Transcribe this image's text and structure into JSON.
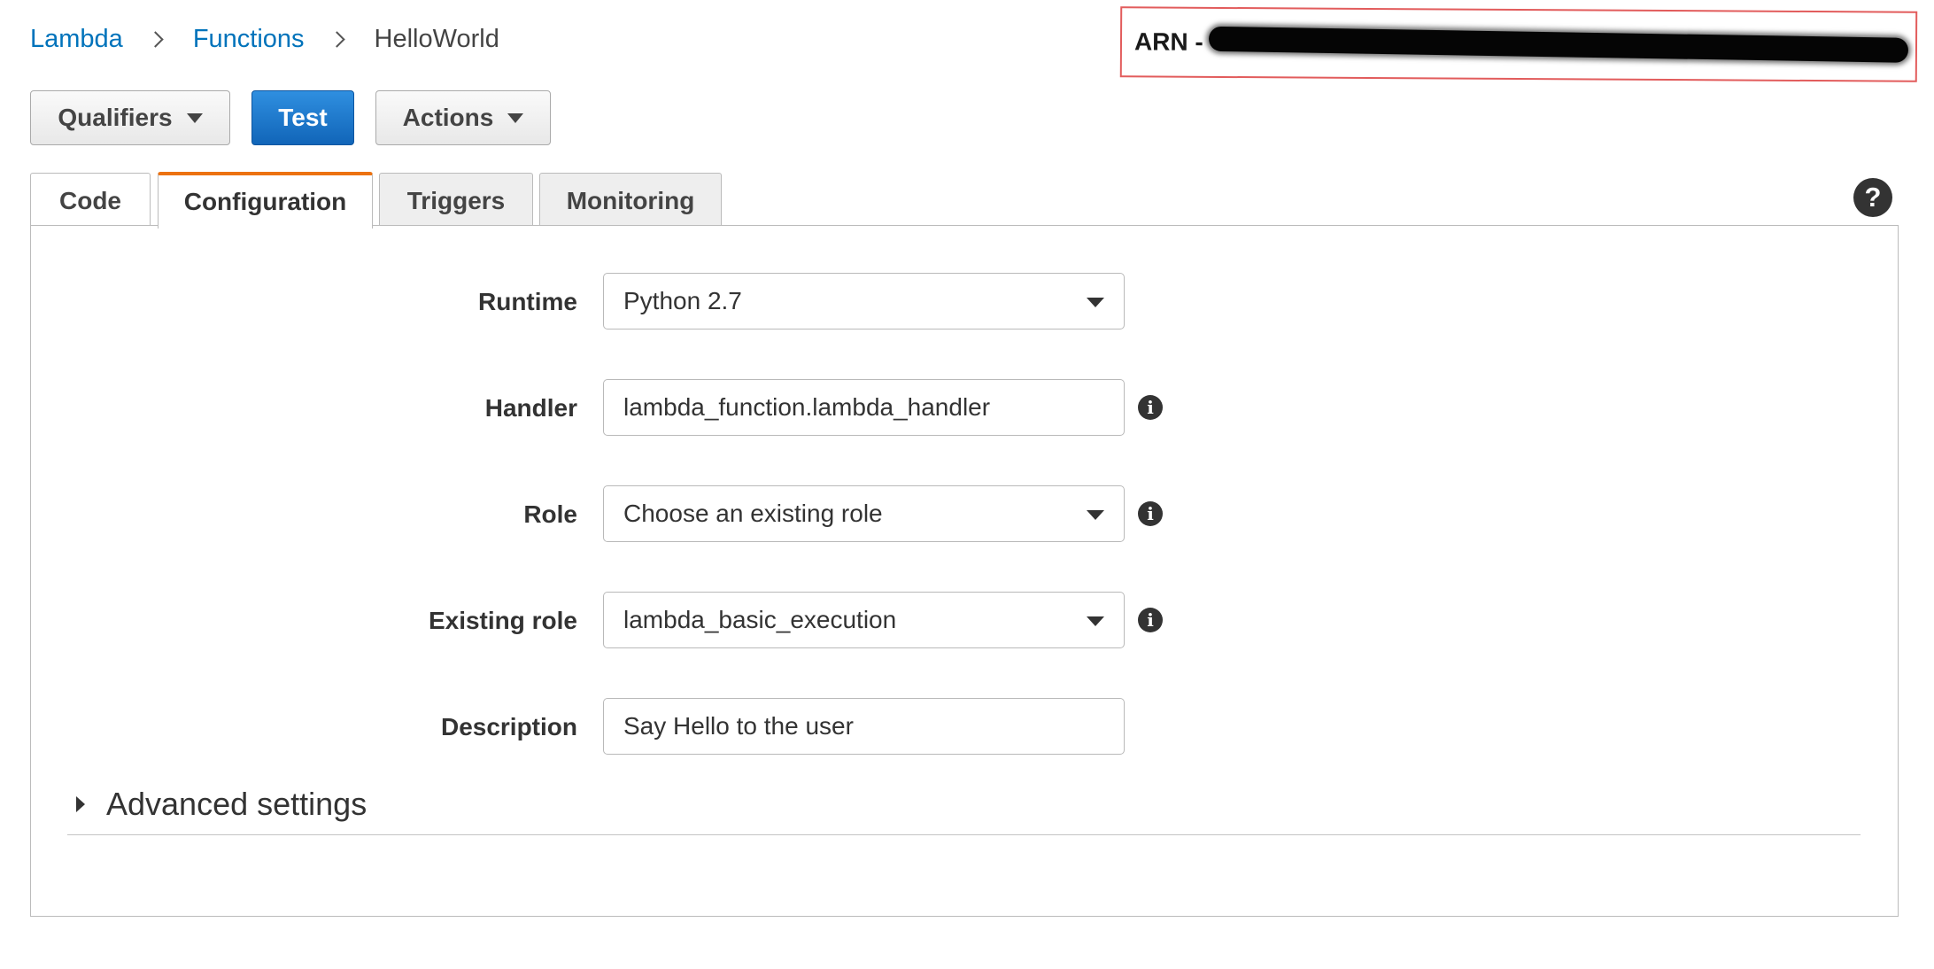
{
  "breadcrumb": {
    "items": [
      {
        "label": "Lambda"
      },
      {
        "label": "Functions"
      },
      {
        "label": "HelloWorld"
      }
    ]
  },
  "arn": {
    "label": "ARN -"
  },
  "toolbar": {
    "qualifiers_label": "Qualifiers",
    "test_label": "Test",
    "actions_label": "Actions"
  },
  "tabs": [
    {
      "label": "Code",
      "active": false
    },
    {
      "label": "Configuration",
      "active": true
    },
    {
      "label": "Triggers",
      "active": false
    },
    {
      "label": "Monitoring",
      "active": false
    }
  ],
  "help": {
    "glyph": "?"
  },
  "form": {
    "runtime": {
      "label": "Runtime",
      "value": "Python 2.7"
    },
    "handler": {
      "label": "Handler",
      "value": "lambda_function.lambda_handler"
    },
    "role": {
      "label": "Role",
      "value": "Choose an existing role"
    },
    "existing_role": {
      "label": "Existing role",
      "value": "lambda_basic_execution"
    },
    "description": {
      "label": "Description",
      "value": "Say Hello to the user"
    }
  },
  "advanced": {
    "label": "Advanced settings"
  },
  "icons": {
    "info": "info-icon",
    "help": "help-icon",
    "breadcrumb_separator": "chevron-right-icon",
    "dropdown": "caret-down-icon",
    "expand": "caret-right-icon"
  },
  "colors": {
    "link": "#0073bb",
    "primary_button": "#1572c7",
    "active_tab_accent": "#ec7211",
    "arn_highlight": "#e25c5c"
  }
}
